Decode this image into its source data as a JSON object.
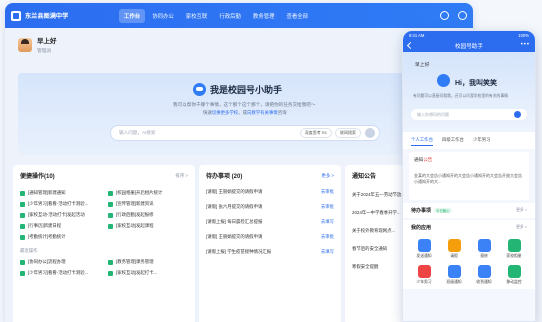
{
  "app": {
    "name": "东兰县图满中学"
  },
  "nav": [
    "工作台",
    "协同办公",
    "家校互联",
    "行政后勤",
    "教务管理",
    "查看全部"
  ],
  "user": {
    "greeting": "早上好",
    "role": "管理员"
  },
  "hero": {
    "title": "我是校园号小助手",
    "sub": "我可以帮你干哪个事情，这个那个这个那个，请把你的任务交给我吧～",
    "sub2_prefix": "快速",
    "sub2_link1": "切换更多学校",
    "sub2_mid": "，或",
    "sub2_link2": "向教学有关事情",
    "sub2_suffix": "咨询",
    "placeholder": "输入问题，AI搜索",
    "chip1": "深度思考 R1",
    "chip2": "联网搜索"
  },
  "ops": {
    "title": "便捷操作(10)",
    "more": "排序 >",
    "items": [
      "[通知管理]新建通知",
      "[校园相册]开启相片统计",
      "[少年男习]看看-活动打卡测验...",
      "[宣传管理]新建资讯",
      "[家校互动-活动打卡]发起活动",
      "[行政后勤]发起报修",
      "[行事历]新建日程",
      "[家校互动]发起课程",
      "[考勤统计]考勤统计"
    ],
    "sub": "最近操作",
    "recent": [
      "[协同办公]流程办理",
      "[教务管理]课务管理",
      "[少年男习]看看-活动打卡测验...",
      "[家校互动]发起打卡..."
    ]
  },
  "todo": {
    "title": "待办事项 (20)",
    "more": "更多 >",
    "rows": [
      {
        "t": "[请假] 王丽娟提交的请假申请",
        "s": "去审批"
      },
      {
        "t": "[请假] 张六月提交的请假申请",
        "s": "去审批"
      },
      {
        "t": "[请假上报] 每日晨检汇总提报",
        "s": "去填写"
      },
      {
        "t": "[请假] 王丽娟提交的请假申请",
        "s": "去审批"
      },
      {
        "t": "[请假上报] 学生疫苗接种情况汇报",
        "s": "去填写"
      }
    ]
  },
  "notice": {
    "title": "通知公告",
    "more": "更多",
    "rows": [
      "关于2024年五一劳动节放...",
      "2024年一中学春季开学...",
      "关于校外教育现网点...",
      "春节后的安全通知",
      "寒假安全提醒"
    ]
  },
  "phone": {
    "time": "9:41 AM",
    "battery": "100%",
    "title": "校园号助手",
    "hello": "早上好",
    "hi": "Hi，我叫笑笑",
    "sub": "有问题可以直接问我哦，还可以问我学校里的有关的事情",
    "placeholder": "输入你想问的问题",
    "tabs": [
      "个人工作台",
      "四级工作台",
      "少年男习"
    ],
    "notice_title_prefix": "通知",
    "notice_title_hl": "公告",
    "notice_body": "金某的大会告小通知开的大会告小通知开的大会告开放大会告小通知开的大...",
    "todo": "待办事项",
    "todo_tag": "今日截止",
    "more": "更多 >",
    "apps_title": "我的应用",
    "apps": [
      "发送通知",
      "请假",
      "报修",
      "家校相册",
      "少年男习",
      "班级通知",
      "收到通知",
      "移动监控"
    ]
  },
  "colors": {
    "primary": "#2c6df0",
    "green": "#22b573",
    "red": "#e0453a"
  }
}
